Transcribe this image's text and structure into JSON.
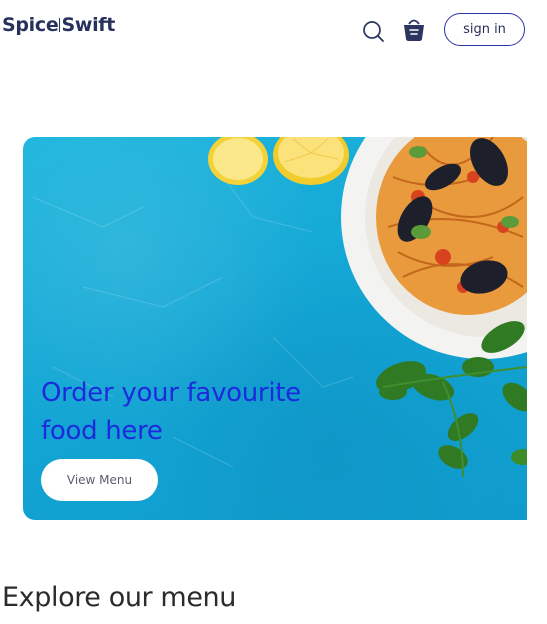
{
  "header": {
    "logo_left": "Spice",
    "logo_right": "Swift",
    "sign_in_label": "sign in",
    "icons": [
      "search-icon",
      "basket-icon"
    ]
  },
  "hero": {
    "title": "Order your favourite food here",
    "button_label": "View Menu",
    "colors": {
      "background": "#14a9d6",
      "title": "#1d2bdc"
    }
  },
  "menu_section": {
    "title": "Explore our menu"
  }
}
